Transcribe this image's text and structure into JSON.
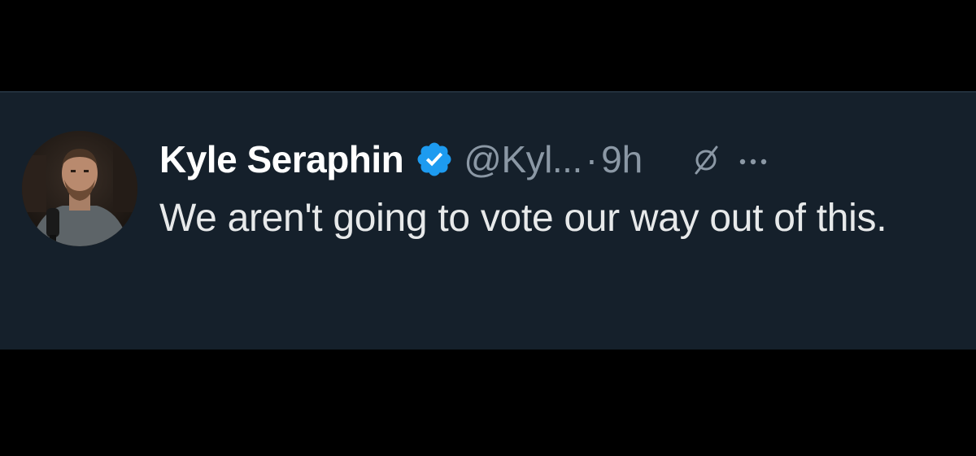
{
  "tweet": {
    "display_name": "Kyle Seraphin",
    "handle": "@Kyl...",
    "separator": "·",
    "time": "9h",
    "text": "We aren't going to vote our way out of this.",
    "icons": {
      "verified": "verified-badge-icon",
      "grok": "slash-circle-icon",
      "more": "more-options-icon"
    }
  },
  "colors": {
    "background": "#000000",
    "card": "#15202b",
    "name": "#ffffff",
    "secondary": "#8b98a5",
    "text": "#e7e9ea",
    "verified": "#1d9bf0"
  }
}
